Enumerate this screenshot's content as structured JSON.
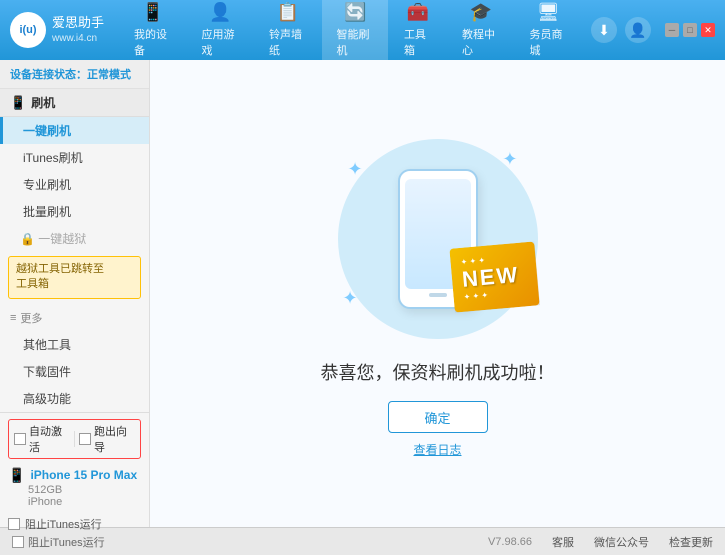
{
  "app": {
    "logo_text_line1": "爱思助手",
    "logo_text_line2": "www.i4.cn",
    "logo_abbr": "i(u)"
  },
  "nav": {
    "tabs": [
      {
        "id": "my-device",
        "icon": "📱",
        "label": "我的设备"
      },
      {
        "id": "apps-games",
        "icon": "👤",
        "label": "应用游戏"
      },
      {
        "id": "ringtones",
        "icon": "📋",
        "label": "铃声墙纸"
      },
      {
        "id": "smart-flash",
        "icon": "🔄",
        "label": "智能刷机",
        "active": true
      },
      {
        "id": "toolbox",
        "icon": "🧰",
        "label": "工具箱"
      },
      {
        "id": "tutorial",
        "icon": "🎓",
        "label": "教程中心"
      },
      {
        "id": "business",
        "icon": "🖥",
        "label": "务员商城"
      }
    ]
  },
  "header_right": {
    "download_icon": "⬇",
    "user_icon": "👤"
  },
  "window_controls": {
    "minimize": "─",
    "maximize": "□",
    "close": "✕"
  },
  "sidebar": {
    "status_label": "设备连接状态：",
    "status_value": "正常模式",
    "flash_group": {
      "icon": "📱",
      "label": "刷机"
    },
    "flash_items": [
      {
        "id": "one-click-flash",
        "label": "一键刷机",
        "active": true
      },
      {
        "id": "itunes-flash",
        "label": "iTunes刷机"
      },
      {
        "id": "pro-flash",
        "label": "专业刷机"
      },
      {
        "id": "batch-flash",
        "label": "批量刷机"
      }
    ],
    "disabled_item": "一键越狱",
    "notice_text": "越狱工具已跳转至\n工具箱",
    "more_section": "更多",
    "more_items": [
      {
        "id": "other-tools",
        "label": "其他工具"
      },
      {
        "id": "download-firmware",
        "label": "下载固件"
      },
      {
        "id": "advanced",
        "label": "高级功能"
      }
    ],
    "auto_activate": "自动激活",
    "guide_restore": "跑出向导",
    "device": {
      "name": "iPhone 15 Pro Max",
      "storage": "512GB",
      "type": "iPhone"
    },
    "itunes_label": "阻止iTunes运行"
  },
  "content": {
    "success_message": "恭喜您，保资料刷机成功啦！",
    "confirm_button": "确定",
    "view_log": "查看日志",
    "new_badge": "NEW"
  },
  "footer": {
    "version": "V7.98.66",
    "items": [
      "客服",
      "微信公众号",
      "检查更新"
    ]
  }
}
